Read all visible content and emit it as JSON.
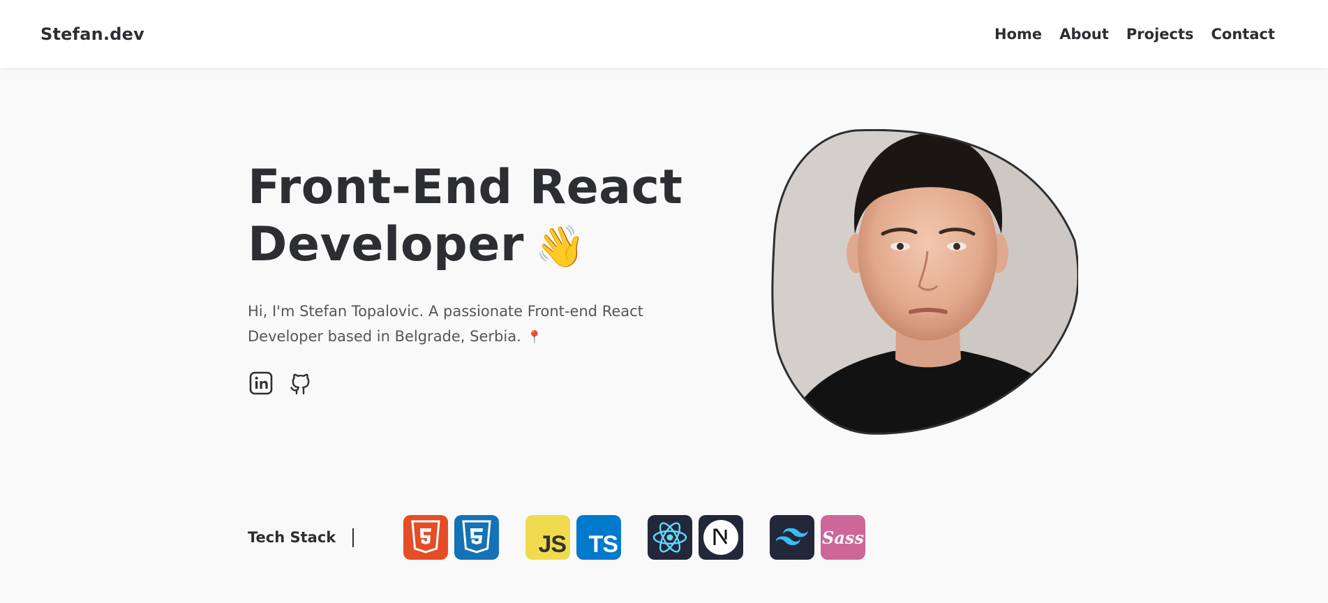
{
  "brand": "Stefan.dev",
  "nav": {
    "home": "Home",
    "about": "About",
    "projects": "Projects",
    "contact": "Contact"
  },
  "hero": {
    "title_line1": "Front-End React",
    "title_line2": "Developer",
    "wave_emoji": "👋",
    "description": "Hi, I'm Stefan Topalovic. A passionate Front-end React Developer based in Belgrade, Serbia.",
    "pin_emoji": "📍",
    "socials": [
      {
        "name": "linkedin-icon"
      },
      {
        "name": "github-icon"
      }
    ],
    "photo": {
      "alt": "portrait-photo"
    }
  },
  "tech_stack": {
    "label": "Tech Stack",
    "icons": [
      {
        "name": "html5-icon",
        "text": "5",
        "bg": "#e44d26"
      },
      {
        "name": "css3-icon",
        "text": "3",
        "bg": "#1572b6"
      },
      {
        "name": "javascript-icon",
        "text": "JS",
        "bg": "#f0db4f"
      },
      {
        "name": "typescript-icon",
        "text": "TS",
        "bg": "#007acc"
      },
      {
        "name": "react-icon",
        "text": "",
        "bg": "#23273a"
      },
      {
        "name": "nextjs-icon",
        "text": "N",
        "bg": "#23273a"
      },
      {
        "name": "tailwind-icon",
        "text": "",
        "bg": "#23273a"
      },
      {
        "name": "sass-icon",
        "text": "Sass",
        "bg": "#cd6799"
      }
    ]
  },
  "colors": {
    "text": "#2d2e32",
    "background": "#f9f9f9",
    "header": "#ffffff",
    "accent_pin": "#e0107a"
  }
}
